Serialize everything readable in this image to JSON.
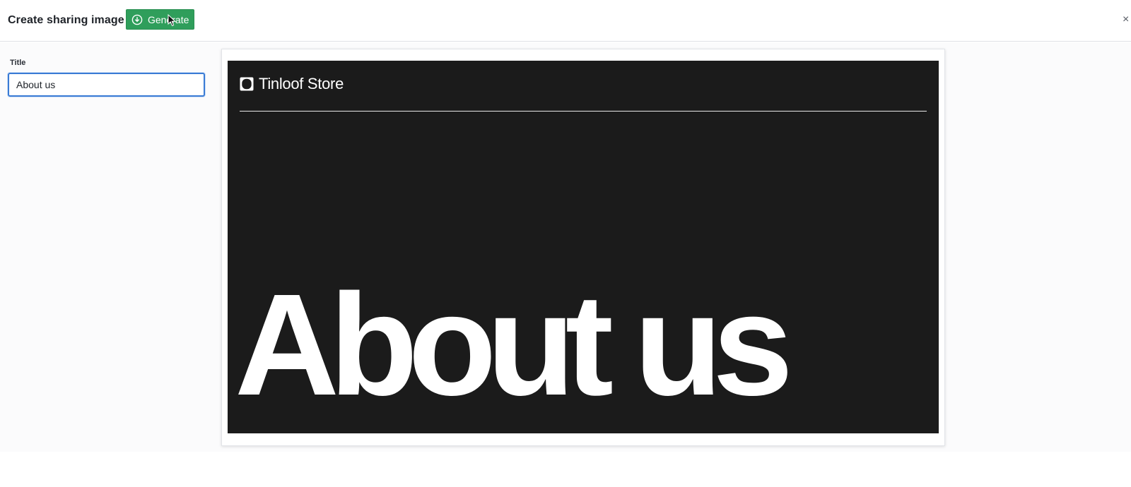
{
  "header": {
    "title": "Create sharing image",
    "generate_label": "Generate",
    "generate_icon": "download-circle-icon",
    "close_icon": "close-icon",
    "close_glyph": "×"
  },
  "form": {
    "title_label": "Title",
    "title_value": "About us"
  },
  "preview": {
    "brand_name": "Tinloof Store",
    "brand_logo_icon": "rounded-square-logo",
    "heading": "About us",
    "background_color": "#1b1b1b",
    "text_color": "#ffffff"
  },
  "colors": {
    "accent": "#2f9e5b",
    "focus": "#3a7bd5"
  }
}
